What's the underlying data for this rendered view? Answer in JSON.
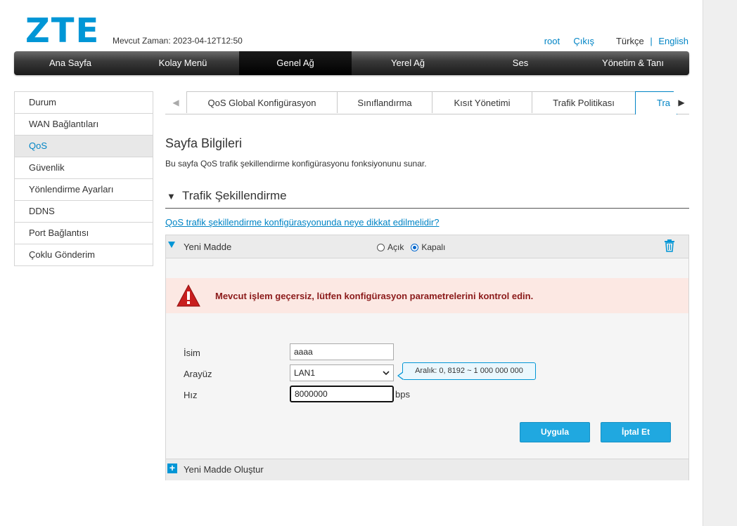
{
  "header": {
    "logo": "ZTE",
    "current_time_label": "Mevcut Zaman:",
    "current_time_value": "2023-04-12T12:50",
    "user": "root",
    "logout": "Çıkış",
    "lang_tr": "Türkçe",
    "lang_sep": "|",
    "lang_en": "English"
  },
  "nav": {
    "items": [
      "Ana Sayfa",
      "Kolay Menü",
      "Genel Ağ",
      "Yerel Ağ",
      "Ses",
      "Yönetim & Tanı"
    ],
    "active": "Genel Ağ"
  },
  "sidebar": {
    "items": [
      "Durum",
      "WAN Bağlantıları",
      "QoS",
      "Güvenlik",
      "Yönlendirme Ayarları",
      "DDNS",
      "Port Bağlantısı",
      "Çoklu Gönderim"
    ],
    "active": "QoS"
  },
  "tabs": {
    "items": [
      "QoS Global Konfigürasyon",
      "Sınıflandırma",
      "Kısıt Yönetimi",
      "Trafik Politikası",
      "Tra"
    ],
    "active": "Tra"
  },
  "page": {
    "title": "Sayfa Bilgileri",
    "description": "Bu sayfa QoS trafik şekillendirme konfigürasyonu fonksiyonunu sunar.",
    "section_title": "Trafik Şekillendirme",
    "help_link": "QoS trafik şekillendirme konfigürasyonunda neye dikkat edilmelidir?"
  },
  "item": {
    "title": "Yeni Madde",
    "radio_on": "Açık",
    "radio_off": "Kapalı",
    "selected": "Kapalı"
  },
  "alert": {
    "message": "Mevcut işlem geçersiz, lütfen konfigürasyon parametrelerini kontrol edin."
  },
  "form": {
    "name_label": "İsim",
    "name_value": "aaaa",
    "interface_label": "Arayüz",
    "interface_value": "LAN1",
    "speed_label": "Hız",
    "speed_value": "8000000",
    "speed_unit": "bps",
    "tooltip": "Aralık: 0, 8192 ~ 1 000 000 000",
    "apply": "Uygula",
    "cancel": "İptal  Et"
  },
  "footer": {
    "create": "Yeni Madde Oluştur"
  },
  "colors": {
    "accent": "#0096d6",
    "link": "#0084c5",
    "button": "#20a8e0",
    "alert_bg": "#fce8e3",
    "alert_text": "#8b1a1a"
  }
}
